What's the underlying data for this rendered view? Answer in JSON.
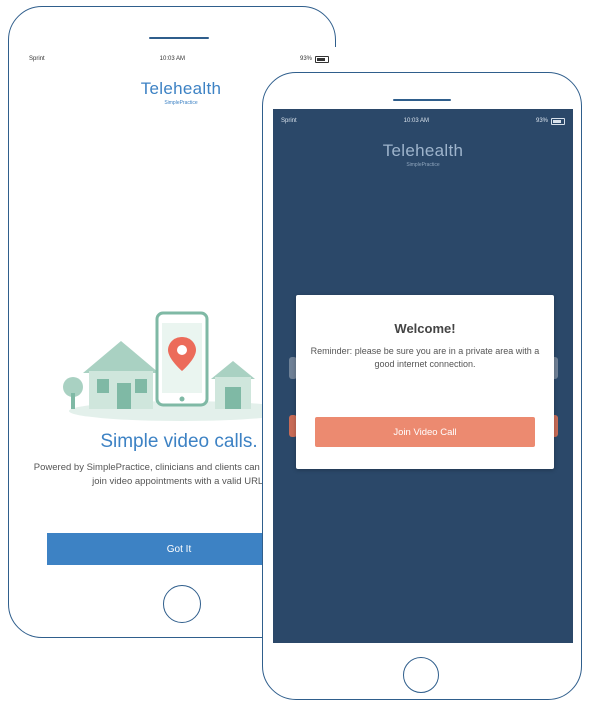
{
  "colors": {
    "outline": "#2f5e8c",
    "brand_blue": "#3d82c4",
    "dark_background": "#2b4869",
    "coral_accent": "#ec8a70",
    "illustration_teal": "#7fb9a5"
  },
  "back_phone": {
    "status_bar": {
      "carrier": "Sprint",
      "time": "10:03 AM",
      "battery": "93%"
    },
    "logo": {
      "title": "Telehealth",
      "subtitle": "SimplePractice"
    },
    "illustration_icon": "house-and-phone-location-illustration",
    "headline": "Simple video calls.",
    "description": "Powered by SimplePractice, clinicians and clients can use this app to join video appointments with a valid URL.",
    "button_label": "Got It"
  },
  "front_phone": {
    "status_bar": {
      "carrier": "Sprint",
      "time": "10:03 AM",
      "battery": "93%"
    },
    "logo": {
      "title": "Telehealth",
      "subtitle": "SimplePractice"
    },
    "modal": {
      "title": "Welcome!",
      "message": "Reminder: please be sure you are in a private area with a good internet connection.",
      "button_label": "Join Video Call"
    }
  }
}
